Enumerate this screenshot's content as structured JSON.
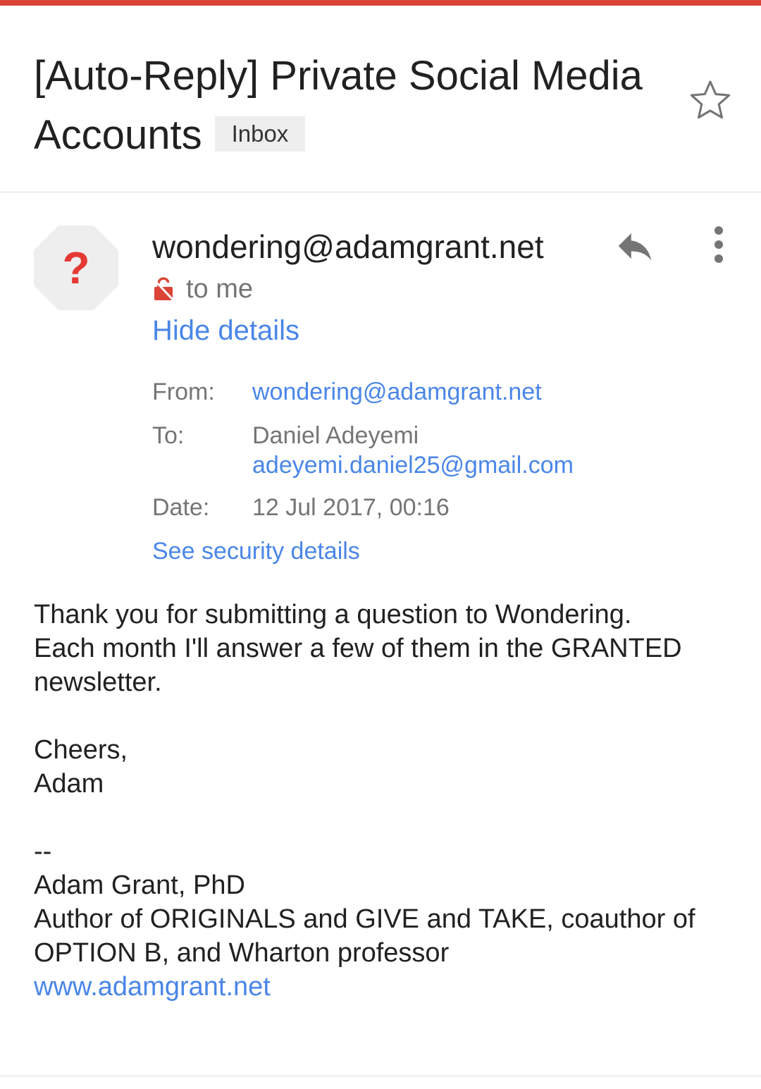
{
  "subject": {
    "title": "[Auto-Reply]  Private Social Media Accounts",
    "label": "Inbox"
  },
  "colors": {
    "accent": "#db4437",
    "link": "#4a86e8",
    "avatar_bg": "#eeeeee",
    "avatar_mark": "#e53935"
  },
  "message": {
    "sender": "wondering@adamgrant.net",
    "recipient_summary": "to me",
    "hide_details": "Hide details",
    "details": {
      "from_label": "From:",
      "from_value": "wondering@adamgrant.net",
      "to_label": "To:",
      "to_name": "Daniel Adeyemi",
      "to_email": "adeyemi.daniel25@gmail.com",
      "date_label": "Date:",
      "date_value": "12 Jul 2017, 00:16"
    },
    "security_link": "See security details",
    "body": {
      "line1": "Thank you for submitting a question to Wondering.",
      "line2": "Each month I'll answer a few of them in the GRANTED",
      "line3": "newsletter.",
      "closing": "Cheers,",
      "name": "Adam",
      "sig_sep": "--",
      "sig_name": "Adam Grant, PhD",
      "sig_line1": "Author of ORIGINALS and GIVE and TAKE, coauthor of",
      "sig_line2": "OPTION B, and Wharton professor",
      "sig_link": "www.adamgrant.net"
    }
  },
  "icons": {
    "star": "star-outline-icon",
    "avatar": "question-mark-avatar",
    "reply": "reply-icon",
    "more": "more-vert-icon",
    "lock": "lock-open-icon"
  }
}
